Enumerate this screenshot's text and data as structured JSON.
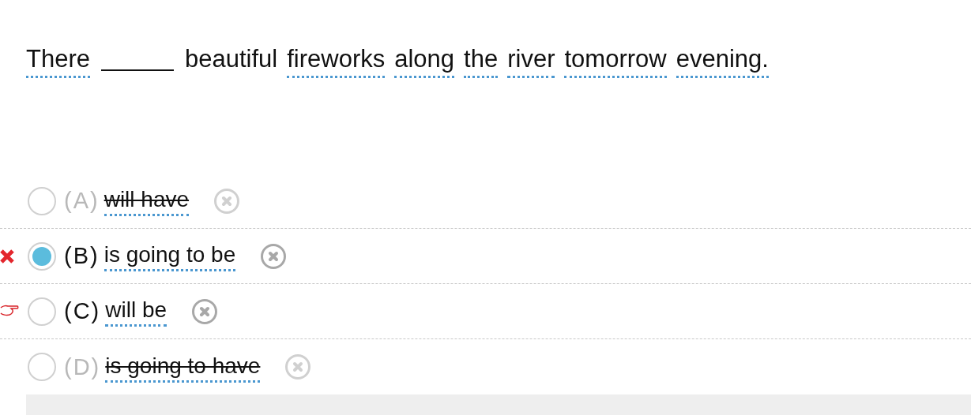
{
  "question": {
    "tokens": [
      {
        "kind": "word",
        "text": "There",
        "underlined": true
      },
      {
        "kind": "blank"
      },
      {
        "kind": "word",
        "text": "beautiful",
        "underlined": false
      },
      {
        "kind": "word",
        "text": "fireworks",
        "underlined": true
      },
      {
        "kind": "word",
        "text": "along",
        "underlined": true
      },
      {
        "kind": "word",
        "text": "the",
        "underlined": true
      },
      {
        "kind": "word",
        "text": "river",
        "underlined": true
      },
      {
        "kind": "word",
        "text": "tomorrow",
        "underlined": true
      },
      {
        "kind": "word",
        "text": "evening.",
        "underlined": true
      }
    ]
  },
  "options": [
    {
      "letter": "(A)",
      "text": "will have",
      "selected": false,
      "eliminated": true,
      "wrong": false,
      "hinted": false
    },
    {
      "letter": "(B)",
      "text": "is going to be",
      "selected": true,
      "eliminated": false,
      "wrong": true,
      "hinted": false
    },
    {
      "letter": "(C)",
      "text": "will be",
      "selected": false,
      "eliminated": false,
      "wrong": false,
      "hinted": true
    },
    {
      "letter": "(D)",
      "text": "is going to have",
      "selected": false,
      "eliminated": true,
      "wrong": false,
      "hinted": false
    }
  ]
}
